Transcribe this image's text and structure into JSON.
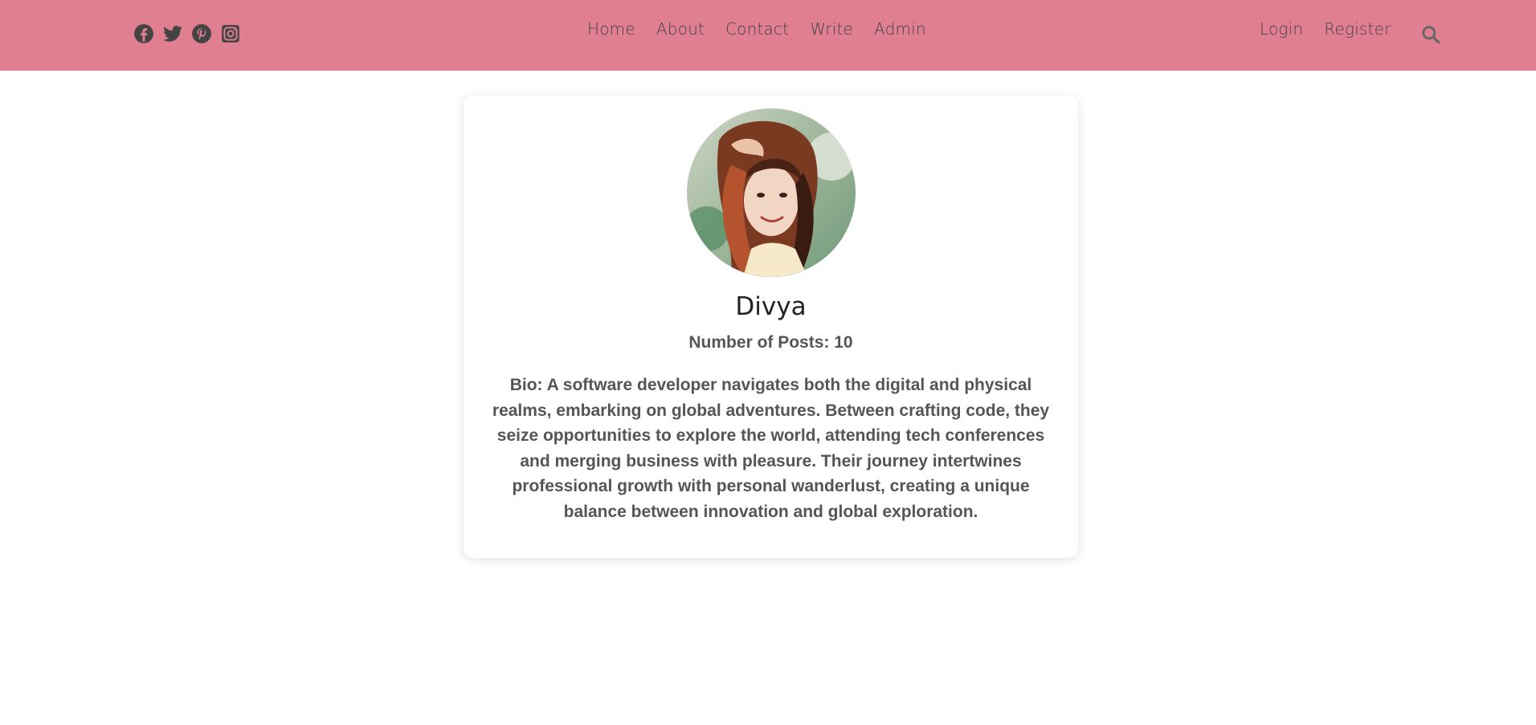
{
  "header": {
    "background_color": "#e07f91",
    "social_icons": [
      "facebook-icon",
      "twitter-icon",
      "pinterest-icon",
      "instagram-icon"
    ],
    "nav": [
      "Home",
      "About",
      "Contact",
      "Write",
      "Admin"
    ],
    "auth": [
      "Login",
      "Register"
    ],
    "search_icon": "search-icon"
  },
  "profile": {
    "name": "Divya",
    "posts_label": "Number of Posts: 10",
    "bio": "Bio: A software developer navigates both the digital and physical realms, embarking on global adventures. Between crafting code, they seize opportunities to explore the world, attending tech conferences and merging business with pleasure. Their journey intertwines professional growth with personal wanderlust, creating a unique balance between innovation and global exploration."
  }
}
